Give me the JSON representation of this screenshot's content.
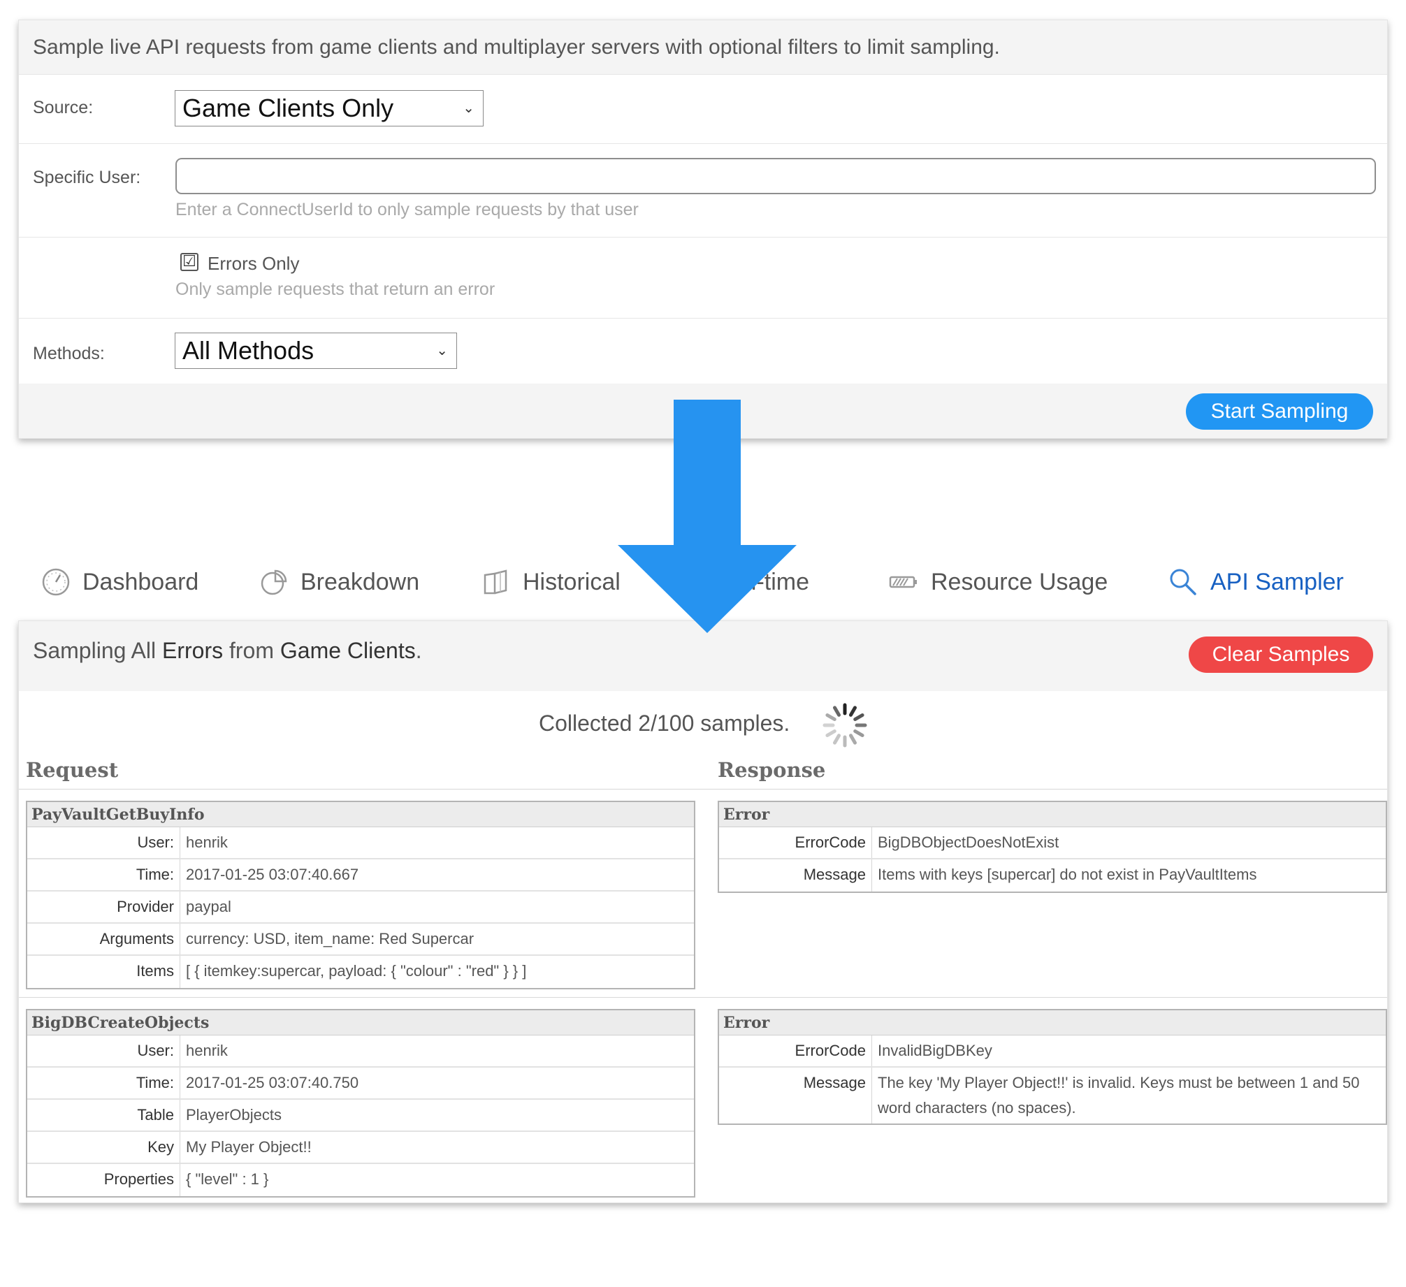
{
  "form": {
    "intro": "Sample live API requests from game clients and multiplayer servers with optional filters to limit sampling.",
    "source_label": "Source:",
    "source_value": "Game Clients Only",
    "user_label": "Specific User:",
    "user_value": "",
    "user_hint": "Enter a ConnectUserId to only sample requests by that user",
    "errors_only_checked": "☑",
    "errors_only_label": "Errors Only",
    "errors_only_hint": "Only sample requests that return an error",
    "methods_label": "Methods:",
    "methods_value": "All Methods",
    "start_label": "Start Sampling"
  },
  "tabs": [
    {
      "label": "Dashboard",
      "icon": "dashboard-gauge-icon"
    },
    {
      "label": "Breakdown",
      "icon": "pie-chart-icon"
    },
    {
      "label": "Historical",
      "icon": "book-icon"
    },
    {
      "label": "al-time",
      "icon": "hidden"
    },
    {
      "label": "Resource Usage",
      "icon": "battery-icon"
    },
    {
      "label": "API Sampler",
      "icon": "search-icon",
      "active": true
    }
  ],
  "results": {
    "title_pre": "Sampling All ",
    "title_errors": "Errors",
    "title_mid": " from ",
    "title_source": "Game Clients",
    "title_post": ".",
    "clear_label": "Clear Samples",
    "collected": "Collected 2/100 samples.",
    "request_heading": "Request",
    "response_heading": "Response",
    "samples": [
      {
        "request": {
          "method": "PayVaultGetBuyInfo",
          "rows": [
            {
              "key": "User:",
              "value": "henrik"
            },
            {
              "key": "Time:",
              "value": "2017-01-25 03:07:40.667"
            },
            {
              "key": "Provider",
              "value": "paypal"
            },
            {
              "key": "Arguments",
              "value": "currency: USD, item_name: Red Supercar"
            },
            {
              "key": "Items",
              "value": "[ { itemkey:supercar, payload: { \"colour\" : \"red\" } } ]"
            }
          ]
        },
        "response": {
          "title": "Error",
          "rows": [
            {
              "key": "ErrorCode",
              "value": "BigDBObjectDoesNotExist"
            },
            {
              "key": "Message",
              "value": "Items with keys [supercar] do not exist in PayVaultItems"
            }
          ]
        }
      },
      {
        "request": {
          "method": "BigDBCreateObjects",
          "rows": [
            {
              "key": "User:",
              "value": "henrik"
            },
            {
              "key": "Time:",
              "value": "2017-01-25 03:07:40.750"
            },
            {
              "key": "Table",
              "value": "PlayerObjects"
            },
            {
              "key": "Key",
              "value": "My Player Object!!"
            },
            {
              "key": "Properties",
              "value": "{ \"level\" : 1 }"
            }
          ]
        },
        "response": {
          "title": "Error",
          "rows": [
            {
              "key": "ErrorCode",
              "value": "InvalidBigDBKey"
            },
            {
              "key": "Message",
              "value": "The key 'My Player Object!!' is invalid. Keys must be between 1 and 50 word characters (no spaces)."
            }
          ]
        }
      }
    ]
  },
  "colors": {
    "primary_button": "#2196f3",
    "danger_button": "#ef4747",
    "active_tab": "#1760c2",
    "arrow": "#2693f0"
  }
}
